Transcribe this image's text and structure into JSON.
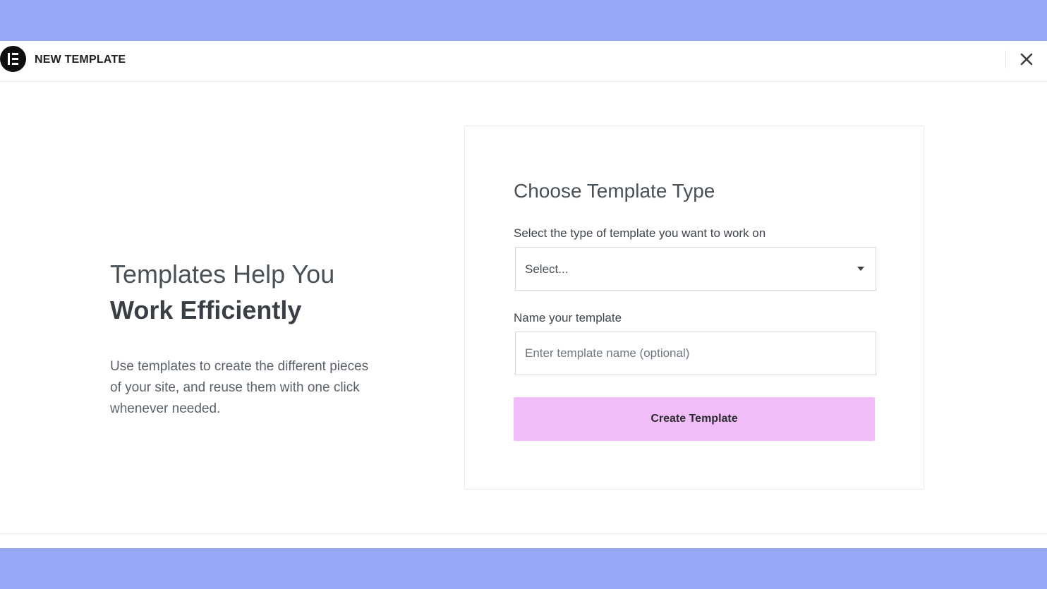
{
  "header": {
    "title": "NEW TEMPLATE",
    "logo_icon": "elementor-logo-icon",
    "close_icon": "close-icon"
  },
  "intro": {
    "title_line1": "Templates Help You",
    "title_line2": "Work Efficiently",
    "description": "Use templates to create the different pieces of your site, and reuse them with one click whenever needed."
  },
  "form": {
    "title": "Choose Template Type",
    "type_label": "Select the type of template you want to work on",
    "type_select_value": "Select...",
    "name_label": "Name your template",
    "name_placeholder": "Enter template name (optional)",
    "submit_label": "Create Template"
  },
  "colors": {
    "backdrop": "#95a7f5",
    "button_bg": "#f1bdf9"
  }
}
